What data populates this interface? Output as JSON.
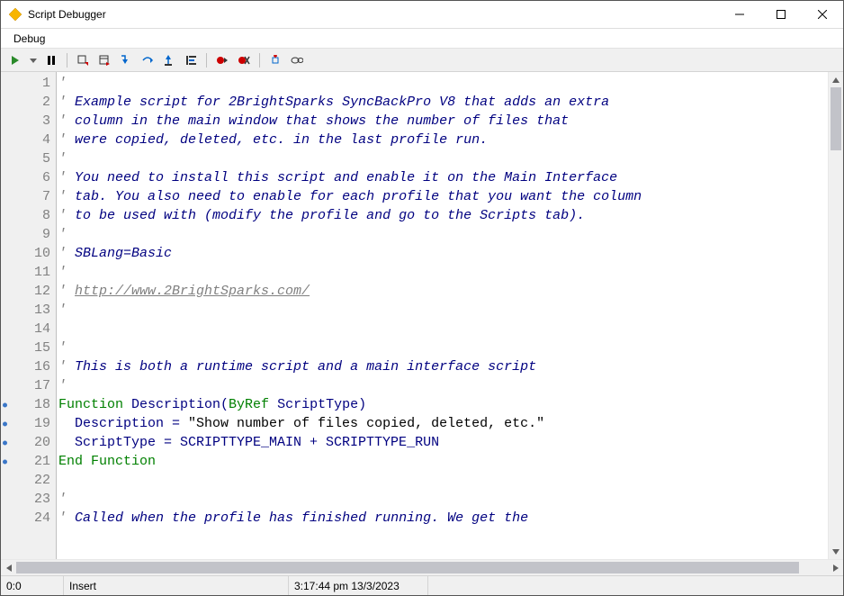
{
  "window": {
    "title": "Script Debugger"
  },
  "menu": {
    "debug": "Debug"
  },
  "toolbar": {
    "run": "run",
    "pause": "pause",
    "stop": "stop",
    "stepinto": "step-into",
    "stepover": "step-over",
    "stepout": "step-out",
    "runtocursor": "run-to-cursor",
    "togglebp": "toggle-breakpoint",
    "clearbp": "clear-breakpoints",
    "watch": "watch",
    "eval": "evaluate",
    "addwatch": "add-watch",
    "view": "view"
  },
  "code": {
    "lines": [
      {
        "n": 1,
        "bp": false,
        "segs": [
          {
            "t": "'",
            "c": "comment"
          }
        ]
      },
      {
        "n": 2,
        "bp": false,
        "segs": [
          {
            "t": "' ",
            "c": "comment"
          },
          {
            "t": "Example script for 2BrightSparks SyncBackPro V8 that adds an extra",
            "c": "text"
          }
        ]
      },
      {
        "n": 3,
        "bp": false,
        "segs": [
          {
            "t": "' ",
            "c": "comment"
          },
          {
            "t": "column in the main window that shows the number of files that",
            "c": "text"
          }
        ]
      },
      {
        "n": 4,
        "bp": false,
        "segs": [
          {
            "t": "' ",
            "c": "comment"
          },
          {
            "t": "were copied, deleted, etc. in the last profile run.",
            "c": "text"
          }
        ]
      },
      {
        "n": 5,
        "bp": false,
        "segs": [
          {
            "t": "'",
            "c": "comment"
          }
        ]
      },
      {
        "n": 6,
        "bp": false,
        "segs": [
          {
            "t": "' ",
            "c": "comment"
          },
          {
            "t": "You need to install this script and enable it on the Main Interface",
            "c": "text"
          }
        ]
      },
      {
        "n": 7,
        "bp": false,
        "segs": [
          {
            "t": "' ",
            "c": "comment"
          },
          {
            "t": "tab. You also need to enable for each profile that you want the column",
            "c": "text"
          }
        ]
      },
      {
        "n": 8,
        "bp": false,
        "segs": [
          {
            "t": "' ",
            "c": "comment"
          },
          {
            "t": "to be used with (modify the profile and go to the Scripts tab).",
            "c": "text"
          }
        ]
      },
      {
        "n": 9,
        "bp": false,
        "segs": [
          {
            "t": "'",
            "c": "comment"
          }
        ]
      },
      {
        "n": 10,
        "bp": false,
        "segs": [
          {
            "t": "' ",
            "c": "comment"
          },
          {
            "t": "SBLang=Basic",
            "c": "text"
          }
        ]
      },
      {
        "n": 11,
        "bp": false,
        "segs": [
          {
            "t": "'",
            "c": "comment"
          }
        ]
      },
      {
        "n": 12,
        "bp": false,
        "segs": [
          {
            "t": "' ",
            "c": "comment"
          },
          {
            "t": "http://www.2BrightSparks.com/",
            "c": "link"
          }
        ]
      },
      {
        "n": 13,
        "bp": false,
        "segs": [
          {
            "t": "'",
            "c": "comment"
          }
        ]
      },
      {
        "n": 14,
        "bp": false,
        "segs": [
          {
            "t": "",
            "c": "comment"
          }
        ]
      },
      {
        "n": 15,
        "bp": false,
        "segs": [
          {
            "t": "'",
            "c": "comment"
          }
        ]
      },
      {
        "n": 16,
        "bp": false,
        "segs": [
          {
            "t": "' ",
            "c": "comment"
          },
          {
            "t": "This is both a runtime script and a main interface script",
            "c": "text"
          }
        ]
      },
      {
        "n": 17,
        "bp": false,
        "segs": [
          {
            "t": "'",
            "c": "comment"
          }
        ]
      },
      {
        "n": 18,
        "bp": true,
        "segs": [
          {
            "t": "Function",
            "c": "kw"
          },
          {
            "t": " Description(",
            "c": "default"
          },
          {
            "t": "ByRef",
            "c": "kw"
          },
          {
            "t": " ScriptType)",
            "c": "default"
          }
        ]
      },
      {
        "n": 19,
        "bp": true,
        "segs": [
          {
            "t": "  Description = ",
            "c": "default"
          },
          {
            "t": "\"Show number of files copied, deleted, etc.\"",
            "c": "str"
          }
        ]
      },
      {
        "n": 20,
        "bp": true,
        "segs": [
          {
            "t": "  ScriptType = SCRIPTTYPE_MAIN + SCRIPTTYPE_RUN",
            "c": "default"
          }
        ]
      },
      {
        "n": 21,
        "bp": true,
        "segs": [
          {
            "t": "End Function",
            "c": "kw"
          }
        ]
      },
      {
        "n": 22,
        "bp": false,
        "segs": [
          {
            "t": "",
            "c": "comment"
          }
        ]
      },
      {
        "n": 23,
        "bp": false,
        "segs": [
          {
            "t": "'",
            "c": "comment"
          }
        ]
      },
      {
        "n": 24,
        "bp": false,
        "segs": [
          {
            "t": "' ",
            "c": "comment"
          },
          {
            "t": "Called when the profile has finished running. We get the",
            "c": "text"
          }
        ]
      }
    ]
  },
  "status": {
    "pos": "0:0",
    "mode": "Insert",
    "time": "3:17:44 pm 13/3/2023"
  }
}
